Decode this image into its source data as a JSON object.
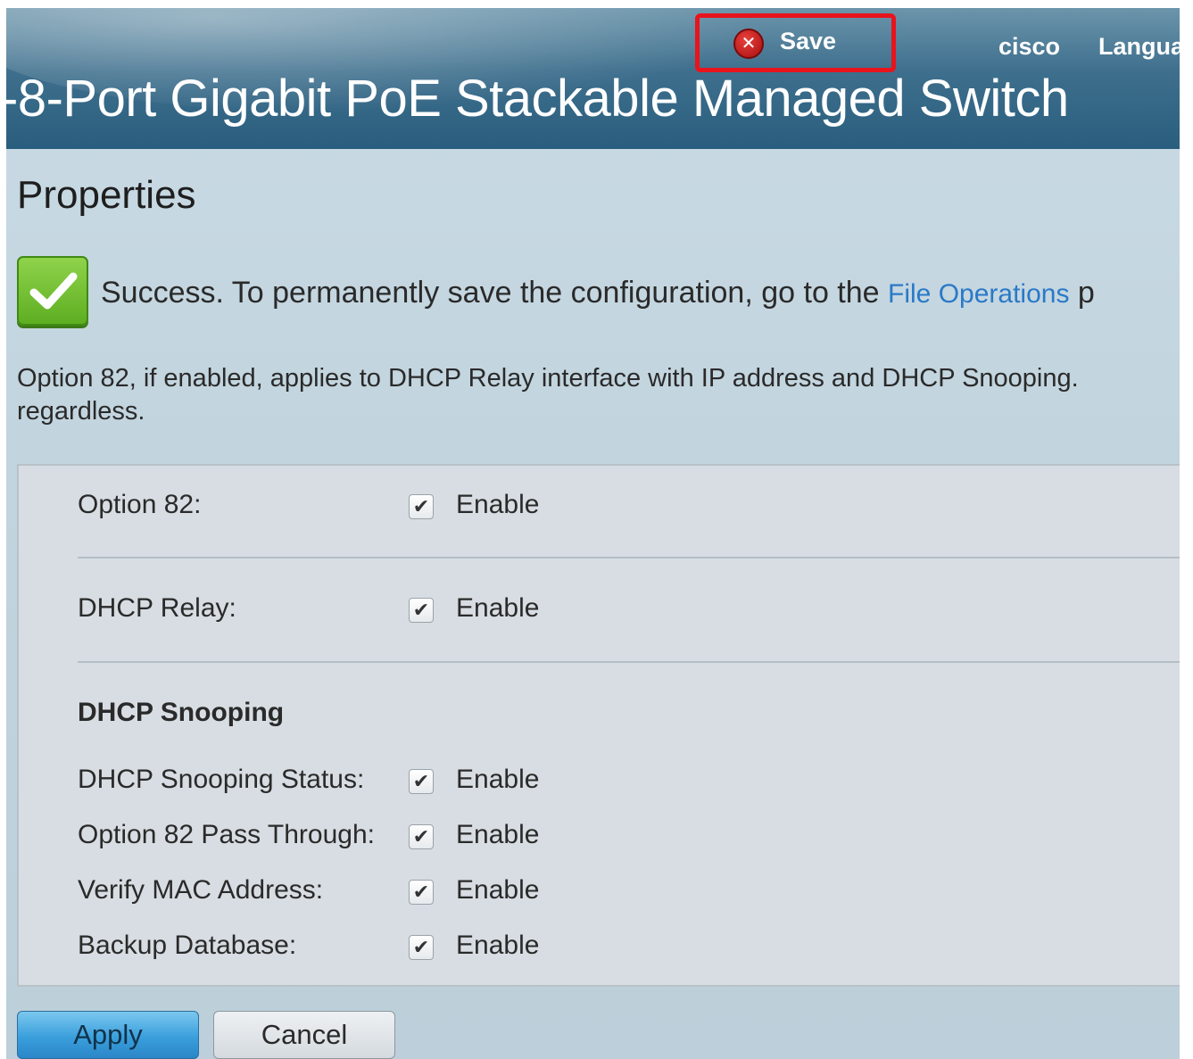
{
  "header": {
    "save_label": "Save",
    "save_icon": "close-circle-icon",
    "brand": "cisco",
    "language": "Langua",
    "device_title": "-8-Port Gigabit PoE Stackable Managed Switch"
  },
  "page": {
    "title": "Properties"
  },
  "success": {
    "icon": "checkmark-icon",
    "message": "Success.  To permanently save the configuration, go to the ",
    "link": "File Operations",
    "message_tail": " p"
  },
  "note": {
    "line1": "Option 82, if enabled, applies to DHCP Relay interface with IP address and DHCP Snooping.",
    "line2": "regardless."
  },
  "form": {
    "option82_label": "Option 82:",
    "dhcp_relay_label": "DHCP Relay:",
    "snooping_section": "DHCP Snooping",
    "snooping_status_label": "DHCP Snooping Status:",
    "pass_through_label": "Option 82 Pass Through:",
    "verify_mac_label": "Verify MAC Address:",
    "backup_db_label": "Backup Database:",
    "enable_label": "Enable",
    "option82_checked": true,
    "dhcp_relay_checked": true,
    "snooping_status_checked": true,
    "pass_through_checked": true,
    "verify_mac_checked": true,
    "backup_db_checked": true
  },
  "buttons": {
    "apply": "Apply",
    "cancel": "Cancel"
  },
  "colors": {
    "header_blue": "#2a5e7e",
    "highlight_red": "#e8141c",
    "success_green": "#5eae22",
    "link_blue": "#2a79c7",
    "apply_blue": "#3a9fdc"
  }
}
